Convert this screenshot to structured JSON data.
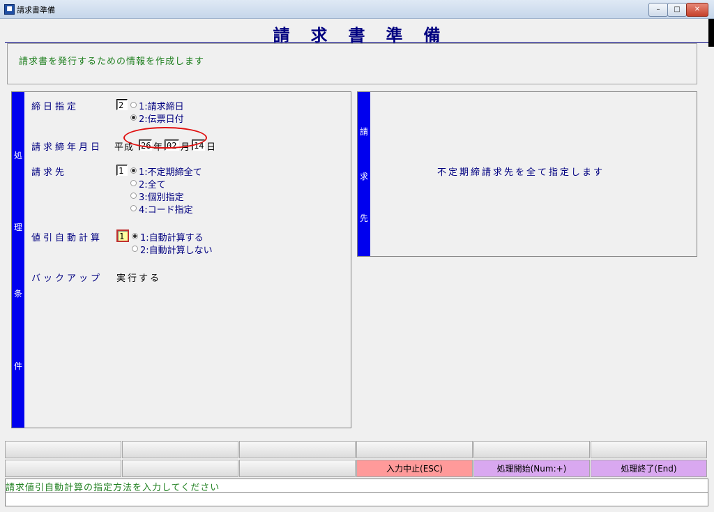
{
  "window": {
    "title": "請求書準備",
    "minimize": "–",
    "maximize": "□",
    "close": "✕"
  },
  "page": {
    "title": "請求書準備",
    "description": "請求書を発行するための情報を作成します"
  },
  "left_panel": {
    "side_label": [
      "処",
      "理",
      "条",
      "件"
    ],
    "closing_spec": {
      "label": "締日指定",
      "value": "2",
      "options": [
        "1:請求締日",
        "2:伝票日付"
      ],
      "selected": 1
    },
    "closing_date": {
      "label": "請求締年月日",
      "era": "平成",
      "year": "26",
      "year_unit": "年",
      "month": "02",
      "month_unit": "月",
      "day": "14",
      "day_unit": "日"
    },
    "billing_target": {
      "label": "請求先",
      "value": "1",
      "options": [
        "1:不定期締全て",
        "2:全て",
        "3:個別指定",
        "4:コード指定"
      ],
      "selected": 0
    },
    "discount_calc": {
      "label": "値引自動計算",
      "value": "1",
      "options": [
        "1:自動計算する",
        "2:自動計算しない"
      ],
      "selected": 0
    },
    "backup": {
      "label": "バックアップ",
      "value": "実行する"
    }
  },
  "right_panel": {
    "side_label": [
      "請",
      "求",
      "先"
    ],
    "message": "不定期締請求先を全て指定します"
  },
  "function_keys": {
    "row1": [
      "",
      "",
      "",
      "",
      "",
      ""
    ],
    "row2": [
      "",
      "",
      "",
      "入力中止(ESC)",
      "処理開始(Num:+)",
      "処理終了(End)"
    ]
  },
  "status": {
    "message": "請求値引自動計算の指定方法を入力してください",
    "message2": ""
  },
  "colors": {
    "accent_blue": "#0000ee",
    "label_navy": "#000080",
    "info_green": "#208020",
    "cancel_red": "#ff9a9a",
    "action_purple": "#d9a8f0",
    "annotation_red": "#e01010"
  }
}
